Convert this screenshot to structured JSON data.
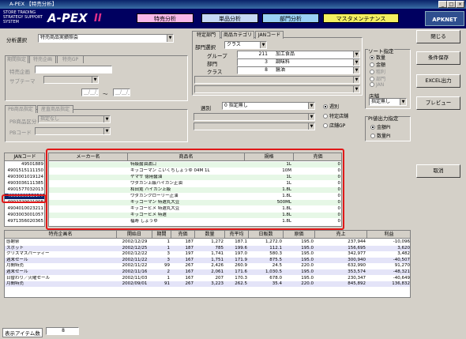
{
  "window": {
    "title": "A-PEX 【特売分析】",
    "min": "_",
    "max": "□",
    "close": "×"
  },
  "logo": {
    "line1": "STORE TRADING",
    "line2": "STRATEGY SUPPORT",
    "line3": "SYSTEM",
    "name": "A-PEX",
    "suffix": "II",
    "brand": "APKNET",
    "brand_small": "Powered by"
  },
  "nav": [
    {
      "label": "特売分析",
      "color": "#f7b8e8"
    },
    {
      "label": "単品分析",
      "color": "#c6d8f4"
    },
    {
      "label": "部門分析",
      "color": "#9ad0f4"
    },
    {
      "label": "マスタメンテナンス",
      "color": "#f4f060"
    }
  ],
  "filters": {
    "analysis_label": "分析選択",
    "analysis_value": "特売商品実績照会",
    "tabs1": [
      "期間指定",
      "特売企画",
      "特売GP"
    ],
    "plan_label": "特売企画",
    "sub_label": "サブテーマ",
    "date_sep": "～",
    "date1": "__/__/__",
    "date2": "__/__/__",
    "pb_tabs": [
      "PB商品指定",
      "産直商品指定"
    ],
    "pb_label": "PB商品区分",
    "pb_value": "指定なし",
    "pb_code_label": "PBコード"
  },
  "section": {
    "tabs": [
      "特定部門",
      "商品カテゴリ",
      "JANコード"
    ],
    "dept_label": "部門選択",
    "dept_value": "クラス",
    "rows": [
      {
        "label": "グループ",
        "code": "211",
        "name": "加工食品"
      },
      {
        "label": "部門",
        "code": "3",
        "name": "調味料"
      },
      {
        "label": "クラス",
        "code": "8",
        "name": "醤油"
      }
    ],
    "week_label": "週別",
    "week_value": "0 指定無し",
    "radio_week": "週別",
    "radio_store": "特定店舗",
    "radio_all": "店舗GP"
  },
  "sort": {
    "title": "ソート指定",
    "options": [
      "数量",
      "金額",
      "粗利",
      "部門",
      "JAN"
    ],
    "selected": "数量",
    "store_label": "店舗",
    "store_value": "指定無し"
  },
  "pi": {
    "title": "PI値出力指定",
    "options": [
      "金額PI",
      "数量PI"
    ],
    "selected": "金額PI"
  },
  "buttons": {
    "close": "閉じる",
    "save": "条件保存",
    "excel": "EXCEL出力",
    "preview": "プレビュー",
    "cancel": "取消"
  },
  "jan_table": {
    "header": "JANコード",
    "rows": [
      "49501889",
      "4901515111150",
      "4903001019124",
      "4903036111385",
      "4901577032013",
      "4903036112177",
      "4902720021008",
      "4904010023211",
      "4903003001057",
      "4971356020365"
    ],
    "selected": "4903036112177"
  },
  "product_table": {
    "headers": [
      "メーカー名",
      "商品名",
      "規格",
      "売価"
    ],
    "rows": [
      [
        "",
        "特級醤油濃口",
        "1L",
        "0"
      ],
      [
        "",
        "キッコーマン こいくちしょうゆ 04M 1L",
        "10M",
        "0"
      ],
      [
        "",
        "ヤマサ 徳用醤油",
        "1L",
        "0"
      ],
      [
        "",
        "ワダカン上級ハイカン正油",
        "1L",
        "0"
      ],
      [
        "",
        "和田寛 ハイカン上級",
        "1.8L",
        "0"
      ],
      [
        "",
        "ワダカンクローリー正油",
        "1.8L",
        "0"
      ],
      [
        "",
        "キッコーマン 特選丸大豆",
        "500ML",
        "0"
      ],
      [
        "",
        "キッコーヒメ 特選丸大豆",
        "1.8L",
        "0"
      ],
      [
        "",
        "キッコーヒメ 特選",
        "1.8L",
        "0"
      ],
      [
        "",
        "福寿 しょうゆ",
        "1.8L",
        "0"
      ]
    ]
  },
  "sales_table": {
    "headers": [
      "特売企画名",
      "開始日",
      "期間",
      "売価",
      "数量",
      "売平均",
      "日販数",
      "原価",
      "売上",
      "利益"
    ],
    "rows": [
      [
        "感謝祭",
        "2002/12/29",
        "1",
        "187",
        "1,272",
        "187.1",
        "1,272.0",
        "195.0",
        "237,944",
        "-10,096"
      ],
      [
        "スポット",
        "2002/12/25",
        "1",
        "187",
        "785",
        "199.6",
        "112.1",
        "195.0",
        "156,695",
        "3,620"
      ],
      [
        "クリスマスパーティー",
        "2002/12/22",
        "3",
        "197",
        "1,741",
        "197.0",
        "580.3",
        "195.0",
        "342,977",
        "3,482"
      ],
      [
        "週末セール",
        "2002/11/22",
        "3",
        "167",
        "1,751",
        "171.9",
        "875.5",
        "195.0",
        "300,940",
        "-40,507"
      ],
      [
        "月間特売",
        "2002/11/22",
        "99",
        "267",
        "2,426",
        "260.9",
        "24.5",
        "220.0",
        "632,990",
        "91,270"
      ],
      [
        "週末セール",
        "2002/11/16",
        "2",
        "167",
        "2,061",
        "171.6",
        "1,030.5",
        "195.0",
        "353,574",
        "-48,321"
      ],
      [
        "日替わり／火曜セール",
        "2002/11/03",
        "1",
        "167",
        "207",
        "170.3",
        "678.0",
        "195.0",
        "230,347",
        "-40,649"
      ],
      [
        "月間特売",
        "2002/09/01",
        "91",
        "267",
        "3,223",
        "262.5",
        "35.4",
        "220.0",
        "845,892",
        "136,832"
      ]
    ]
  },
  "status": {
    "label": "表示アイテム数",
    "value": "8"
  }
}
